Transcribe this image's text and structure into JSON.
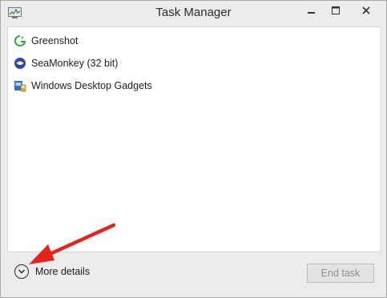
{
  "window": {
    "title": "Task Manager",
    "icon": "task-manager-icon",
    "controls": [
      "minimize-icon",
      "maximize-icon",
      "close-icon"
    ]
  },
  "processes": [
    {
      "name": "Greenshot",
      "icon": "greenshot-icon"
    },
    {
      "name": "SeaMonkey (32 bit)",
      "icon": "seamonkey-icon"
    },
    {
      "name": "Windows Desktop Gadgets",
      "icon": "gadgets-icon"
    }
  ],
  "footer": {
    "more_details_label": "More details",
    "end_task_label": "End task"
  },
  "annotation": {
    "arrow_color": "#e8211c"
  }
}
